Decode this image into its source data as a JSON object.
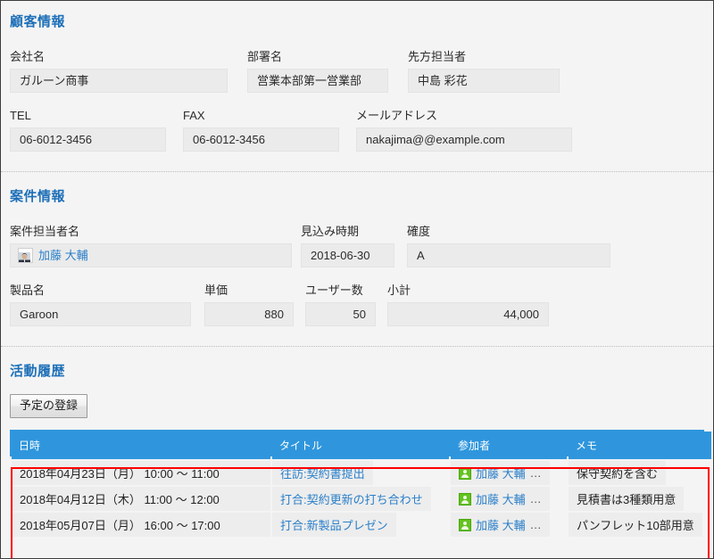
{
  "customer_section": {
    "title": "顧客情報",
    "fields": [
      {
        "label": "会社名",
        "value": "ガルーン商事"
      },
      {
        "label": "部署名",
        "value": "営業本部第一営業部"
      },
      {
        "label": "先方担当者",
        "value": "中島 彩花"
      },
      {
        "label": "TEL",
        "value": "06-6012-3456"
      },
      {
        "label": "FAX",
        "value": "06-6012-3456"
      },
      {
        "label": "メールアドレス",
        "value": "nakajima@@example.com"
      }
    ]
  },
  "deal_section": {
    "title": "案件情報",
    "fields": [
      {
        "label": "案件担当者名",
        "value": "加藤 大輔",
        "icon": "avatar-photo-icon"
      },
      {
        "label": "見込み時期",
        "value": "2018-06-30"
      },
      {
        "label": "確度",
        "value": "A"
      },
      {
        "label": "製品名",
        "value": "Garoon"
      },
      {
        "label": "単価",
        "value": "880"
      },
      {
        "label": "ユーザー数",
        "value": "50"
      },
      {
        "label": "小計",
        "value": "44,000"
      }
    ]
  },
  "activity_section": {
    "title": "活動履歴",
    "add_button_label": "予定の登録",
    "columns": [
      "日時",
      "タイトル",
      "参加者",
      "メモ"
    ],
    "rows": [
      {
        "datetime": "2018年04月23日（月） 10:00 〜 11:00",
        "title": "往訪:契約書提出",
        "participant": "加藤 大輔",
        "participant_more": "…",
        "participant_icon": "user-green-icon",
        "memo": "保守契約を含む"
      },
      {
        "datetime": "2018年04月12日（木） 11:00 〜 12:00",
        "title": "打合:契約更新の打ち合わせ",
        "participant": "加藤 大輔",
        "participant_more": "…",
        "participant_icon": "user-green-icon",
        "memo": "見積書は3種類用意"
      },
      {
        "datetime": "2018年05月07日（月） 16:00 〜 17:00",
        "title": "打合:新製品プレゼン",
        "participant": "加藤 大輔",
        "participant_more": "…",
        "participant_icon": "user-green-icon",
        "memo": "パンフレット10部用意"
      }
    ]
  },
  "colors": {
    "section_title": "#1d6fb8",
    "table_header_bg": "#2f96dd",
    "link": "#2a7fc9",
    "highlight_box": "#ff0000",
    "field_bg": "#ebebeb",
    "page_bg": "#f4f4f4"
  }
}
